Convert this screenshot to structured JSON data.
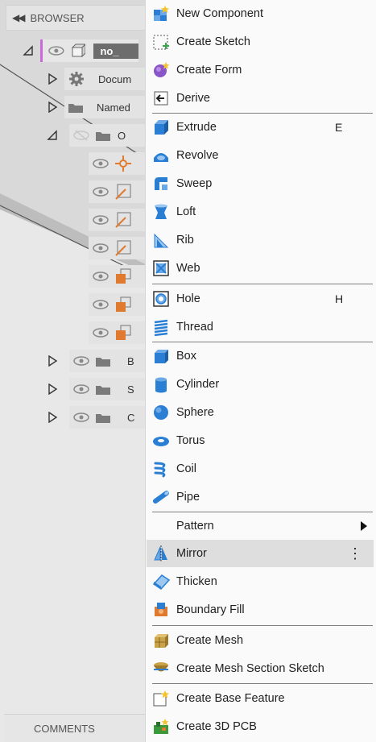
{
  "browser": {
    "collapse_glyph": "◀◀",
    "title": "BROWSER",
    "rows": [
      {
        "text": "no_",
        "kind": "component"
      },
      {
        "text": "Docum",
        "kind": "settings"
      },
      {
        "text": "Named",
        "kind": "folder"
      },
      {
        "text": "O",
        "kind": "folder-hidden"
      },
      {
        "text": "",
        "kind": "origin-point"
      },
      {
        "text": "",
        "kind": "origin-axis"
      },
      {
        "text": "",
        "kind": "origin-axis"
      },
      {
        "text": "",
        "kind": "origin-axis"
      },
      {
        "text": "",
        "kind": "origin-plane"
      },
      {
        "text": "",
        "kind": "origin-plane"
      },
      {
        "text": "",
        "kind": "origin-plane"
      },
      {
        "text": "B",
        "kind": "folder"
      },
      {
        "text": "S",
        "kind": "folder"
      },
      {
        "text": "C",
        "kind": "folder"
      }
    ]
  },
  "comments": {
    "label": "COMMENTS"
  },
  "menu": {
    "items": [
      {
        "label": "New Component",
        "icon": "new-component-icon"
      },
      {
        "label": "Create Sketch",
        "icon": "create-sketch-icon"
      },
      {
        "label": "Create Form",
        "icon": "create-form-icon"
      },
      {
        "label": "Derive",
        "icon": "derive-icon"
      },
      {
        "label": "Extrude",
        "icon": "extrude-icon",
        "shortcut": "E"
      },
      {
        "label": "Revolve",
        "icon": "revolve-icon"
      },
      {
        "label": "Sweep",
        "icon": "sweep-icon"
      },
      {
        "label": "Loft",
        "icon": "loft-icon"
      },
      {
        "label": "Rib",
        "icon": "rib-icon"
      },
      {
        "label": "Web",
        "icon": "web-icon"
      },
      {
        "label": "Hole",
        "icon": "hole-icon",
        "shortcut": "H"
      },
      {
        "label": "Thread",
        "icon": "thread-icon"
      },
      {
        "label": "Box",
        "icon": "box-icon"
      },
      {
        "label": "Cylinder",
        "icon": "cylinder-icon"
      },
      {
        "label": "Sphere",
        "icon": "sphere-icon"
      },
      {
        "label": "Torus",
        "icon": "torus-icon"
      },
      {
        "label": "Coil",
        "icon": "coil-icon"
      },
      {
        "label": "Pipe",
        "icon": "pipe-icon"
      },
      {
        "label": "Pattern",
        "icon": "",
        "submenu": true
      },
      {
        "label": "Mirror",
        "icon": "mirror-icon",
        "highlighted": true
      },
      {
        "label": "Thicken",
        "icon": "thicken-icon"
      },
      {
        "label": "Boundary Fill",
        "icon": "boundary-fill-icon"
      },
      {
        "label": "Create Mesh",
        "icon": "create-mesh-icon"
      },
      {
        "label": "Create Mesh Section Sketch",
        "icon": "mesh-section-sketch-icon"
      },
      {
        "label": "Create Base Feature",
        "icon": "base-feature-icon"
      },
      {
        "label": "Create 3D PCB",
        "icon": "pcb-3d-icon"
      }
    ],
    "more_glyph": "⋮"
  },
  "colors": {
    "accent_blue": "#2a7fd4",
    "orange": "#e07a2e",
    "purple_marker": "#c86ad8",
    "highlight": "#dedede"
  }
}
